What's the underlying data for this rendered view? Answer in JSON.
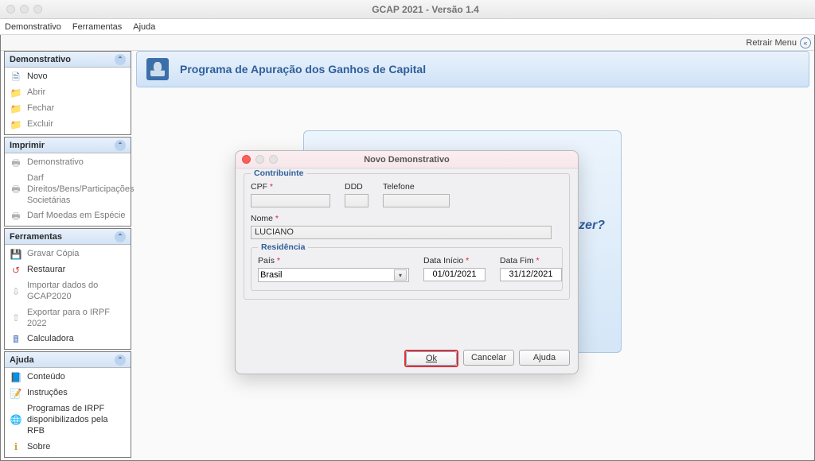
{
  "window": {
    "title": "GCAP 2021 - Versão 1.4"
  },
  "menubar": [
    "Demonstrativo",
    "Ferramentas",
    "Ajuda"
  ],
  "retrair": {
    "label": "Retrair Menu"
  },
  "sidebar": {
    "panels": [
      {
        "title": "Demonstrativo",
        "items": [
          {
            "icon": "doc",
            "label": "Novo",
            "enabled": true
          },
          {
            "icon": "folder",
            "label": "Abrir",
            "enabled": false
          },
          {
            "icon": "folder",
            "label": "Fechar",
            "enabled": false
          },
          {
            "icon": "folder",
            "label": "Excluir",
            "enabled": false
          }
        ]
      },
      {
        "title": "Imprimir",
        "items": [
          {
            "icon": "printer",
            "label": "Demonstrativo",
            "enabled": false
          },
          {
            "icon": "printer",
            "label": "Darf Direitos/Bens/Participações Societárias",
            "enabled": false
          },
          {
            "icon": "printer",
            "label": "Darf Moedas em Espécie",
            "enabled": false
          }
        ]
      },
      {
        "title": "Ferramentas",
        "items": [
          {
            "icon": "save",
            "label": "Gravar Cópia",
            "enabled": false
          },
          {
            "icon": "restore",
            "label": "Restaurar",
            "enabled": true,
            "iconClass": "ic-red"
          },
          {
            "icon": "import",
            "label": "Importar dados do GCAP2020",
            "enabled": false
          },
          {
            "icon": "export",
            "label": "Exportar para o IRPF 2022",
            "enabled": false
          },
          {
            "icon": "calc",
            "label": "Calculadora",
            "enabled": true,
            "iconClass": "ic-calc"
          }
        ]
      },
      {
        "title": "Ajuda",
        "items": [
          {
            "icon": "book",
            "label": "Conteúdo",
            "enabled": true,
            "iconClass": "ic-yellow"
          },
          {
            "icon": "note",
            "label": "Instruções",
            "enabled": true,
            "iconClass": "ic-red"
          },
          {
            "icon": "globe",
            "label": "Programas de IRPF disponibilizados pela RFB",
            "enabled": true,
            "iconClass": "ic-green"
          },
          {
            "icon": "info",
            "label": "Sobre",
            "enabled": true,
            "iconClass": "ic-yellow"
          }
        ]
      }
    ]
  },
  "header": {
    "title": "Programa de Apuração dos Ganhos de Capital"
  },
  "content": {
    "prompt_fragment": "azer?"
  },
  "modal": {
    "title": "Novo Demonstrativo",
    "group_contribuinte": "Contribuinte",
    "cpf_label": "CPF",
    "ddd_label": "DDD",
    "telefone_label": "Telefone",
    "nome_label": "Nome",
    "nome_value": "LUCIANO",
    "group_residencia": "Residência",
    "pais_label": "País",
    "pais_value": "Brasil",
    "data_inicio_label": "Data Início",
    "data_inicio_value": "01/01/2021",
    "data_fim_label": "Data Fim",
    "data_fim_value": "31/12/2021",
    "buttons": {
      "ok": "Ok",
      "cancelar": "Cancelar",
      "ajuda": "Ajuda"
    }
  }
}
